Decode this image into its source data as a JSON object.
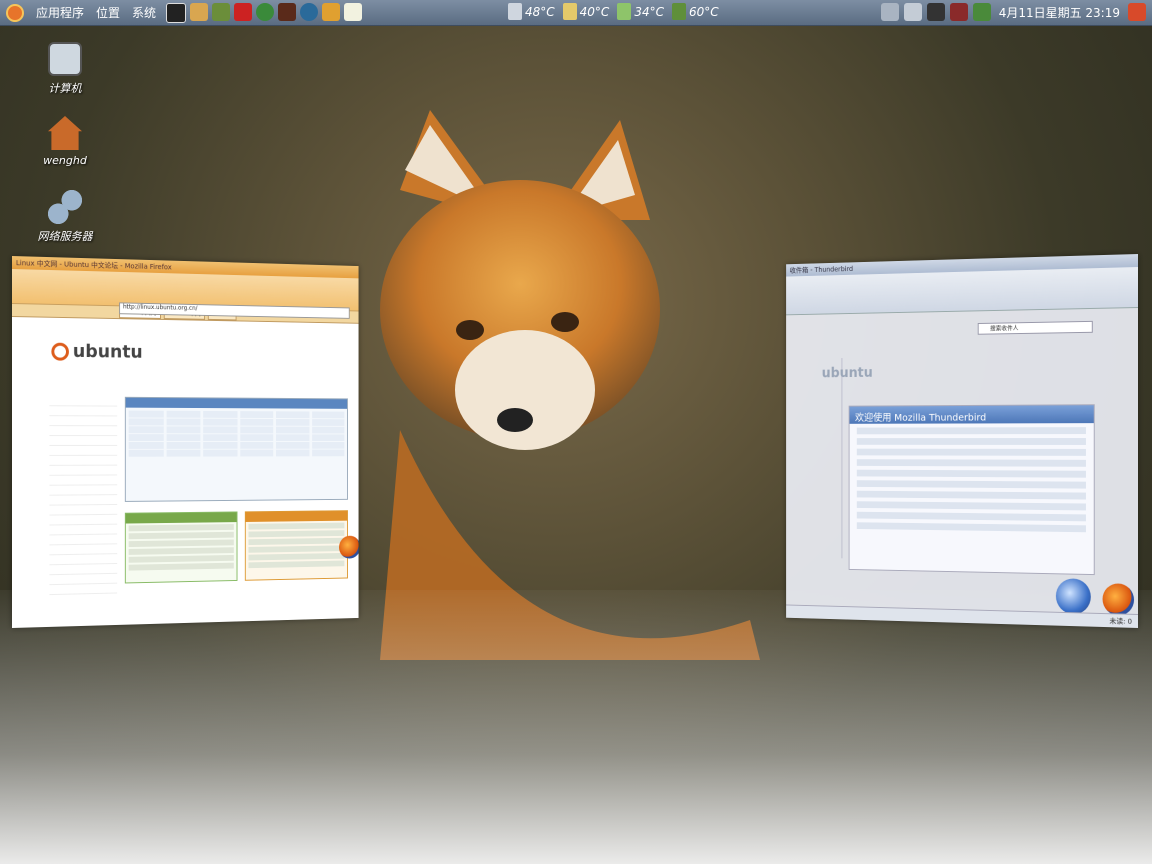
{
  "panel": {
    "menu": [
      "应用程序",
      "位置",
      "系统"
    ],
    "sensors": [
      {
        "icon": "cpu-temp-icon",
        "value": "48°C",
        "color": "#cfd6df"
      },
      {
        "icon": "hdd-temp-icon",
        "value": "40°C",
        "color": "#e4c96a"
      },
      {
        "icon": "gpu-temp-icon",
        "value": "34°C",
        "color": "#8ec46a"
      },
      {
        "icon": "board-temp-icon",
        "value": "60°C",
        "color": "#5f8f3a"
      }
    ],
    "clock": "4月11日星期五 23:19",
    "launcher_icons": [
      "terminal-icon",
      "cat-icon",
      "edit-icon",
      "ruby-icon",
      "chrome-icon",
      "media-icon",
      "globe-icon",
      "penguin-icon",
      "notepad-icon"
    ],
    "tray_icons": [
      "network-icon",
      "volume-icon",
      "tray-monitor-icon",
      "tray-app-icon",
      "update-icon"
    ]
  },
  "desktop": {
    "icons": [
      {
        "name": "computer-icon",
        "label": "计算机"
      },
      {
        "name": "home-icon",
        "label": "wenghd"
      },
      {
        "name": "network-servers-icon",
        "label": "网络服务器"
      }
    ]
  },
  "windows": {
    "firefox": {
      "title": "Linux 中文网 - Ubuntu 中文论坛 - Mozilla Firefox",
      "url": "http://linux.ubuntu.org.cn/",
      "tabs": [
        "Linux中文网",
        "Ubuntu中文",
        "Google"
      ],
      "brand": "ubuntu"
    },
    "thunderbird": {
      "title": "收件箱 - Thunderbird",
      "welcome_heading": "欢迎使用 Mozilla Thunderbird",
      "brand": "ubuntu",
      "search_placeholder": "搜索收件人",
      "status": "未读: 0"
    }
  }
}
